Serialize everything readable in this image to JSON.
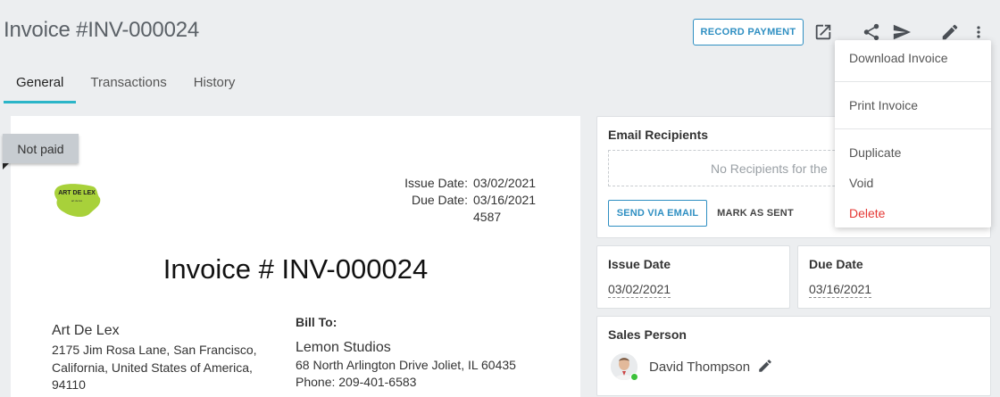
{
  "header": {
    "title": "Invoice #INV-000024",
    "record_payment_label": "RECORD PAYMENT",
    "icons": [
      "open-external-icon",
      "share-icon",
      "send-icon",
      "edit-icon",
      "more-vert-icon"
    ]
  },
  "tabs": [
    {
      "label": "General",
      "active": true
    },
    {
      "label": "Transactions",
      "active": false
    },
    {
      "label": "History",
      "active": false
    }
  ],
  "invoice": {
    "status": "Not paid",
    "logo_text": "ART DE LEX",
    "logo_sub": "art de lex",
    "meta_labels": [
      "Issue Date:",
      "Due Date:"
    ],
    "meta_values": [
      "03/02/2021",
      "03/16/2021",
      "4587"
    ],
    "title": "Invoice # INV-000024",
    "from": {
      "name": "Art De Lex",
      "address_lines": [
        "2175 Jim Rosa Lane, San Francisco,",
        "California, United States of America,",
        "94110"
      ]
    },
    "bill_to": {
      "label": "Bill To:",
      "name": "Lemon Studios",
      "address": "68 North Arlington Drive Joliet, IL 60435",
      "phone": "Phone: 209-401-6583"
    }
  },
  "email_recipients": {
    "label": "Email Recipients",
    "placeholder": "No Recipients for the",
    "send_label": "SEND VIA EMAIL",
    "mark_sent_label": "MARK AS SENT"
  },
  "issue_date": {
    "label": "Issue Date",
    "value": "03/02/2021"
  },
  "due_date": {
    "label": "Due Date",
    "value": "03/16/2021"
  },
  "sales_person": {
    "label": "Sales Person",
    "name": "David Thompson"
  },
  "menu": {
    "items": [
      "Download Invoice",
      "Print Invoice",
      "Duplicate",
      "Void",
      "Delete"
    ]
  },
  "colors": {
    "accent": "#2f8fc2",
    "tab_underline": "#2bb5c8",
    "danger": "#e53935",
    "online": "#3cc13b",
    "logo": "#a8d13a"
  }
}
